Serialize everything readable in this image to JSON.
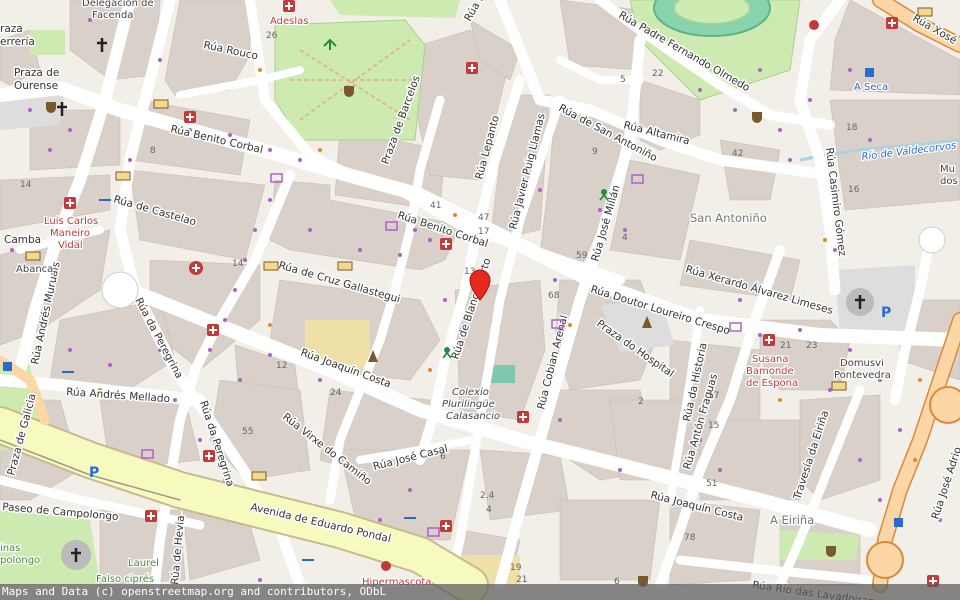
{
  "map": {
    "attribution": "Maps and Data (c) openstreetmap.org and contributors, ODbL",
    "marker_icon": "map-pin-icon",
    "colors": {
      "background": "#f2efe9",
      "building": "#d9d0c9",
      "road": "#ffffff",
      "park": "#cdebb0",
      "primary_road": "#fcd6a4",
      "marker": "#e8281f",
      "poi_red": "#c43a3a",
      "poi_brown": "#7a5a2c"
    },
    "streets": {
      "rouco": "Rúa Rouco",
      "benito_corbal_w": "Rúa Benito Corbal",
      "benito_corbal_e": "Rúa Benito Corbal",
      "castelao": "Rúa de Castelao",
      "cruz_gallastegui": "Rúa de Cruz Gallastegui",
      "joaquin_costa_w": "Rúa Joaquín Costa",
      "joaquin_costa_e": "Rúa Joaquín Costa",
      "andres_mellado": "Rúa Andrés Mellado",
      "andres_muruais": "Rúa Andrés Muruais",
      "da_peregrina_n": "Rúa da Peregrina",
      "da_peregrina_s": "Rúa da Peregrina",
      "virxe_camino": "Rúa Virxe do Camiño",
      "jose_casal": "Rúa José Casal",
      "eduardo_pondal": "Avenida de Eduardo Pondal",
      "paseo_campolongo": "Paseo de Campolongo",
      "praza_galicia": "Praza de Galicia",
      "hevia": "Rúa de Hevia",
      "barcelos": "Praza de Barcelos",
      "lepanto": "Rúa Lepanto",
      "javier_puig": "Rúa Javier Puig Llamas",
      "blanco_porto": "Rúa de Blanco Porto",
      "jose_millan": "Rúa José Millán",
      "cobian_arenal": "Rúa Cobian Arenal",
      "san_antonino": "Rúa de San Antoniño",
      "altamira": "Rúa Altamira",
      "padre_fernando": "Rúa Padre Fernando Olmedo",
      "xerardo": "Rúa Xerardo Álvarez Limeses",
      "doutor_loureiro": "Rúa Doutor Loureiro Crespo",
      "casimiro_gomez": "Rúa Casimiro Gómez",
      "da_historia": "Rúa da Historia",
      "anton_fraguas": "Rúa Antón Fraguas",
      "travesia_eirina": "Travesía da Eiriña",
      "jose_adrio": "Rúa José Adrio",
      "xose": "Rúa Xosé",
      "rio_das_lavadoiras": "Rúa Río das Lavadoiras",
      "camba": "Camba",
      "river": "Río de Valdecorvos",
      "pe": "Rúa Pe"
    },
    "places": {
      "praza_ourense_1": "Praza de",
      "praza_ourense_2": "Ourense",
      "praza_ferraria_1": "raza",
      "praza_ferraria_2": "errería",
      "san_antonino": "San Antoniño",
      "a_eirina": "A Eiriña",
      "praza_hospital": "Praza do Hospital",
      "a_seca": "A Seca",
      "delegacion_1": "Delegación de",
      "delegacion_2": "Facenda",
      "adeslas": "Adeslas",
      "luis_carlos_1": "Luis Carlos",
      "luis_carlos_2": "Maneiro",
      "luis_carlos_3": "Vidal",
      "abanca": "Abanca",
      "colexio_1": "Colexio",
      "colexio_2": "Plurilingüe",
      "colexio_3": "Calasancio",
      "susana_1": "Susana",
      "susana_2": "Bamonde",
      "susana_3": "de Espona",
      "domusvi_1": "Domusvi",
      "domusvi_2": "Pontevedra",
      "hipermascota": "Hipermascota",
      "laurel": "Laurel",
      "falso_cipres": "Falso ciprés",
      "museo_1": "Mu",
      "museo_2": "dos",
      "campolongo_1": "inas",
      "campolongo_2": "polongo"
    },
    "house_numbers": [
      "26",
      "8",
      "14",
      "41",
      "47",
      "17",
      "13",
      "14",
      "12",
      "24",
      "55",
      "6",
      "68",
      "59",
      "4",
      "9",
      "5",
      "22",
      "42",
      "18",
      "16",
      "21",
      "23",
      "17",
      "15",
      "2",
      "51",
      "78",
      "2.4",
      "4",
      "19",
      "21",
      "6"
    ]
  }
}
